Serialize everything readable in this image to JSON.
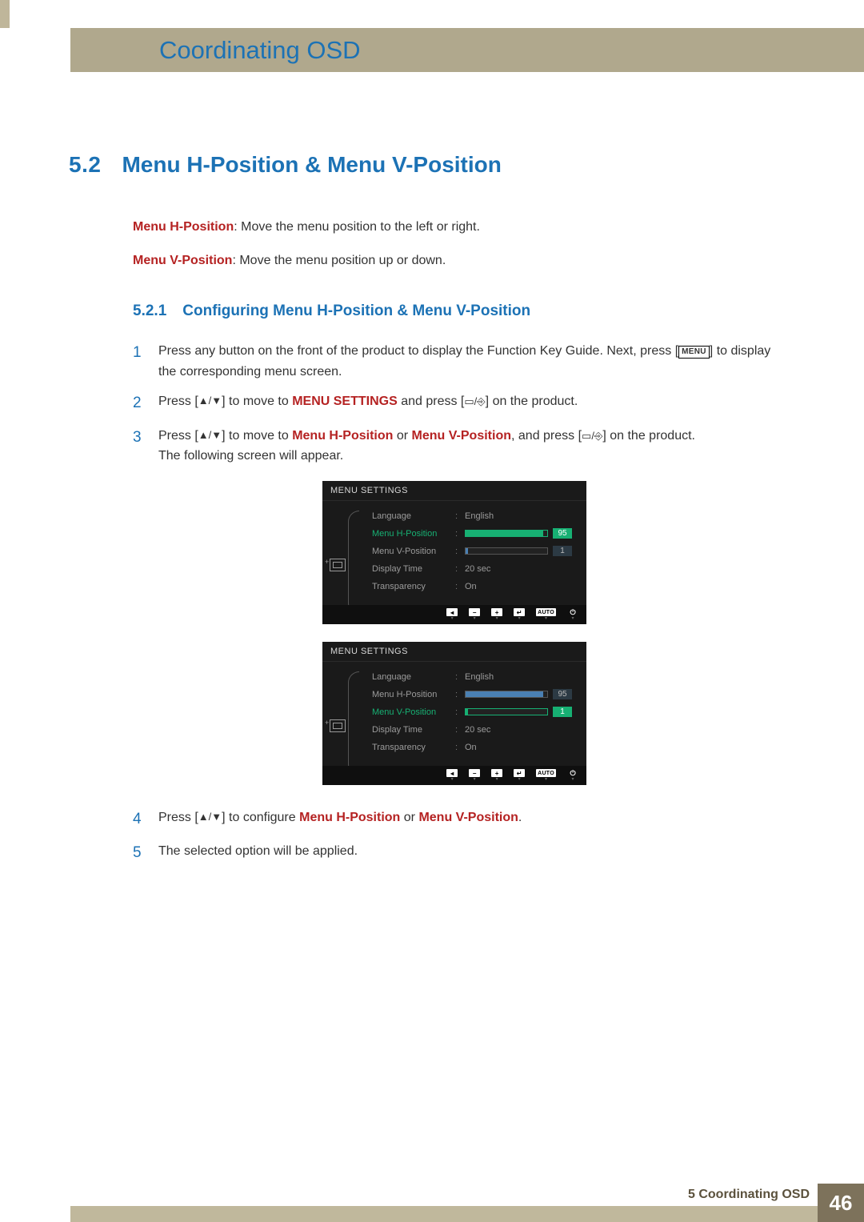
{
  "chapter_title": "Coordinating OSD",
  "section": {
    "num": "5.2",
    "title": "Menu H-Position & Menu V-Position"
  },
  "intro": {
    "h_label": "Menu H-Position",
    "h_desc": ": Move the menu position to the left or right.",
    "v_label": "Menu V-Position",
    "v_desc": ": Move the menu position up or down."
  },
  "subsec": {
    "num": "5.2.1",
    "title": "Configuring Menu H-Position & Menu V-Position"
  },
  "steps": {
    "s1_a": "Press any button on the front of the product to display the Function Key Guide. Next, press [",
    "s1_menu": "MENU",
    "s1_b": "] to display the corresponding menu screen.",
    "s2_a": "Press [",
    "s2_b": "] to move to ",
    "s2_hl": "MENU SETTINGS",
    "s2_c": " and press [",
    "s2_d": "] on the product.",
    "s3_a": "Press [",
    "s3_b": "] to move to ",
    "s3_hl1": "Menu H-Position",
    "s3_mid": " or ",
    "s3_hl2": "Menu V-Position",
    "s3_c": ", and press [",
    "s3_d": "] on the product.",
    "s3_e": "The following screen will appear.",
    "s4_a": "Press [",
    "s4_b": "] to configure ",
    "s4_hl1": "Menu H-Position",
    "s4_mid": " or ",
    "s4_hl2": "Menu V-Position",
    "s4_c": ".",
    "s5": "The selected option will be applied."
  },
  "step_nums": {
    "n1": "1",
    "n2": "2",
    "n3": "3",
    "n4": "4",
    "n5": "5"
  },
  "osd": {
    "title": "MENU SETTINGS",
    "rows": {
      "language": {
        "label": "Language",
        "value": "English"
      },
      "h": {
        "label": "Menu H-Position",
        "value": "95",
        "pct": 95
      },
      "v": {
        "label": "Menu V-Position",
        "value": "1",
        "pct": 1
      },
      "display_time": {
        "label": "Display Time",
        "value": "20 sec"
      },
      "transparency": {
        "label": "Transparency",
        "value": "On"
      }
    },
    "footer": {
      "auto": "AUTO"
    }
  },
  "footer": {
    "chapter": "5 Coordinating OSD",
    "page": "46"
  }
}
